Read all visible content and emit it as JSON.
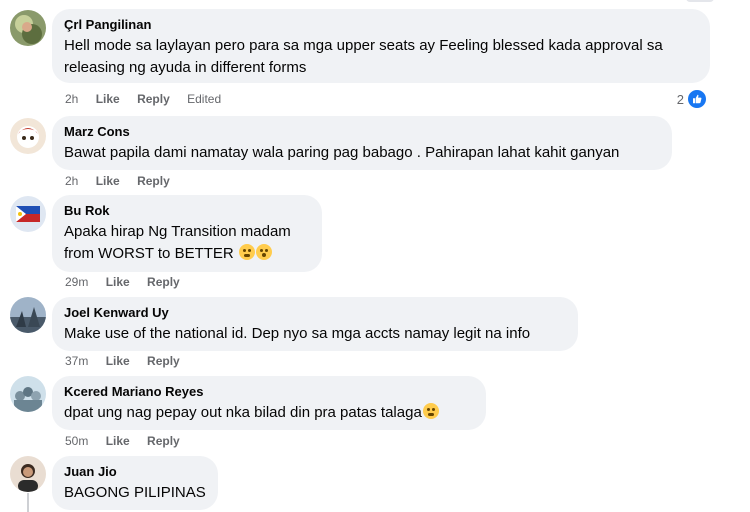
{
  "comments": [
    {
      "author": "Çrl Pangilinan",
      "text": "Hell mode sa laylayan pero para sa mga upper seats ay Feeling blessed kada approval sa releasing ng ayuda in different forms",
      "time": "2h",
      "like": "Like",
      "reply": "Reply",
      "edited": "Edited",
      "reaction_count": "2",
      "reaction_icon": "like-icon"
    },
    {
      "author": "Marz Cons",
      "text": "Bawat papila dami namatay wala paring pag babago . Pahirapan lahat kahit ganyan",
      "time": "2h",
      "like": "Like",
      "reply": "Reply"
    },
    {
      "author": "Bu Rok",
      "text_line1": "Apaka hirap Ng Transition madam",
      "text_line2": "from WORST to BETTER",
      "emojis": [
        "grimacing-face-icon",
        "fearful-face-icon"
      ],
      "time": "29m",
      "like": "Like",
      "reply": "Reply"
    },
    {
      "author": "Joel Kenward Uy",
      "text": "Make use of the national id. Dep nyo sa mga accts namay legit na info",
      "time": "37m",
      "like": "Like",
      "reply": "Reply"
    },
    {
      "author": "Kcered Mariano Reyes",
      "text": "dpat ung nag pepay out nka bilad din pra patas talaga",
      "emojis": [
        "grimacing-face-icon"
      ],
      "time": "50m",
      "like": "Like",
      "reply": "Reply"
    },
    {
      "author": "Juan Jio",
      "text": "BAGONG PILIPINAS"
    }
  ],
  "colors": {
    "bubble": "#f0f2f5",
    "meta_text": "#65676b",
    "like_blue": "#1877f2"
  }
}
